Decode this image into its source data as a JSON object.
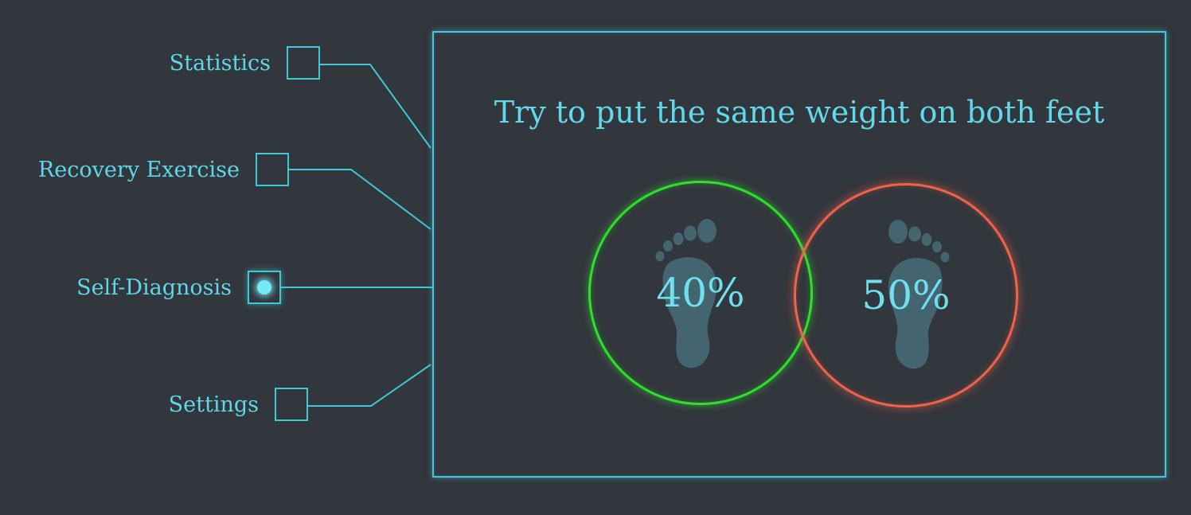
{
  "nav": {
    "items": [
      {
        "label": "Statistics",
        "active": false
      },
      {
        "label": "Recovery Exercise",
        "active": false
      },
      {
        "label": "Self-Diagnosis",
        "active": true
      },
      {
        "label": "Settings",
        "active": false
      }
    ]
  },
  "panel": {
    "instruction": "Try to put the same weight on both feet",
    "left_foot": {
      "value": "40%",
      "ring_color": "#2fe02a",
      "icon": "left-footprint-icon"
    },
    "right_foot": {
      "value": "50%",
      "ring_color": "#f0624a",
      "icon": "right-footprint-icon"
    }
  },
  "colors": {
    "background": "#32363d",
    "accent": "#46c6dd",
    "text": "#5fd7e8",
    "footprint": "#44656f"
  }
}
